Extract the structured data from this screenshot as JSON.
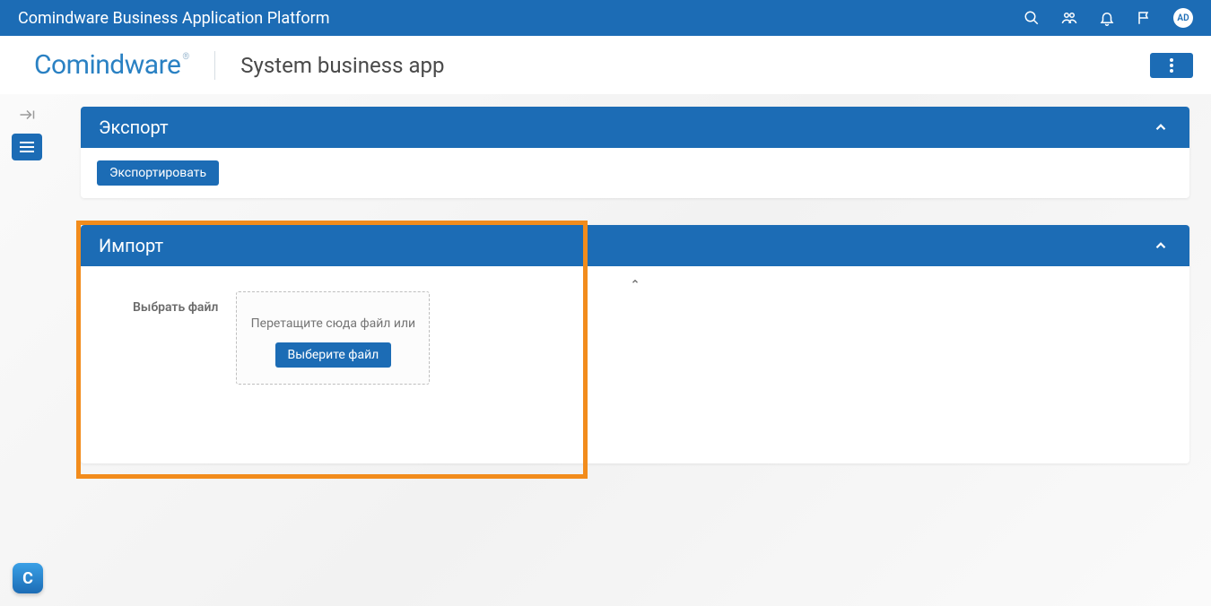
{
  "topbar": {
    "title": "Comindware Business Application Platform",
    "avatar": "AD"
  },
  "header": {
    "logo_main": "Comindware",
    "logo_sup": "®",
    "page_title": "System business app"
  },
  "panels": {
    "export": {
      "title": "Экспорт",
      "button": "Экспортировать"
    },
    "import": {
      "title": "Импорт",
      "file_label": "Выбрать файл",
      "dropzone_text": "Перетащите сюда файл или",
      "choose_button": "Выберите файл"
    }
  },
  "siderail": {
    "bottom_badge": "C"
  }
}
